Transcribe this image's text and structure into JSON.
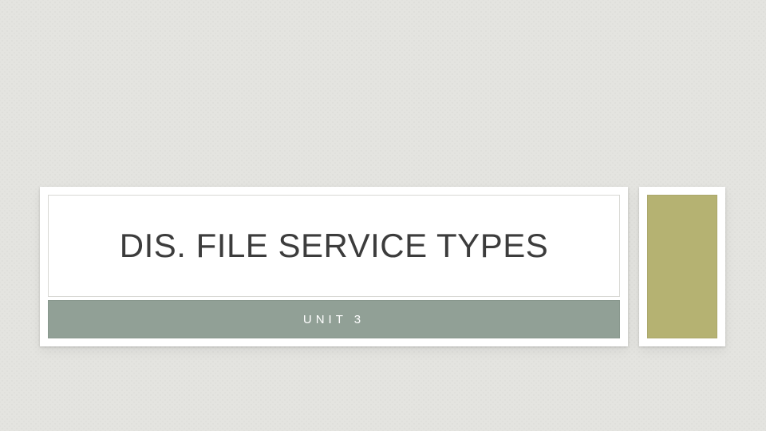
{
  "slide": {
    "title": "DIS. FILE SERVICE TYPES",
    "subtitle": "UNIT 3"
  },
  "colors": {
    "background": "#e4e4e0",
    "panel": "#ffffff",
    "subtitle_band": "#91a096",
    "accent_block": "#b5b272",
    "title_text": "#3c3c3c",
    "subtitle_text": "#ffffff"
  }
}
